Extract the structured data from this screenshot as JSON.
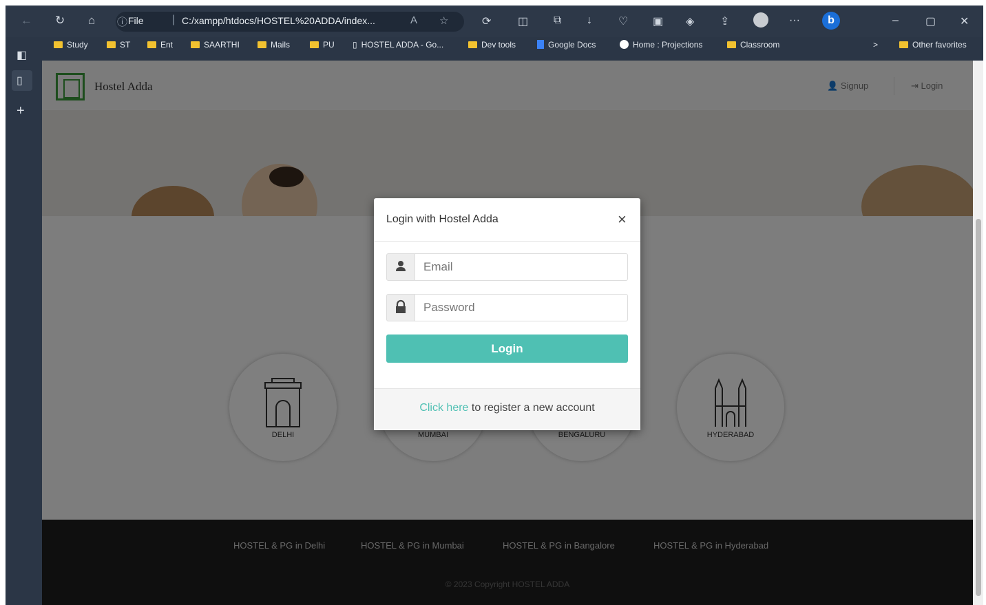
{
  "browser": {
    "address": {
      "scheme": "File",
      "url": "C:/xampp/htdocs/HOSTEL%20ADDA/index..."
    },
    "bookmarks": [
      "Study",
      "ST",
      "Ent",
      "SAARTHI",
      "Mails",
      "PU",
      "HOSTEL ADDA - Go...",
      "Dev tools",
      "Google Docs",
      "Home : Projections",
      "Classroom"
    ],
    "other_favorites": "Other favorites"
  },
  "site": {
    "brand": "Hostel Adda",
    "nav": {
      "signup": "Signup",
      "login": "Login"
    },
    "cities": [
      "DELHI",
      "MUMBAI",
      "BENGALURU",
      "HYDERABAD"
    ],
    "footer": {
      "links": [
        "HOSTEL & PG in Delhi",
        "HOSTEL & PG in Mumbai",
        "HOSTEL & PG in Bangalore",
        "HOSTEL & PG in Hyderabad"
      ],
      "copyright": "© 2023 Copyright HOSTEL ADDA"
    }
  },
  "modal": {
    "title": "Login with Hostel Adda",
    "close": "×",
    "email_placeholder": "Email",
    "password_placeholder": "Password",
    "login_button": "Login",
    "register_link": "Click here",
    "register_text": "to register a new account"
  }
}
